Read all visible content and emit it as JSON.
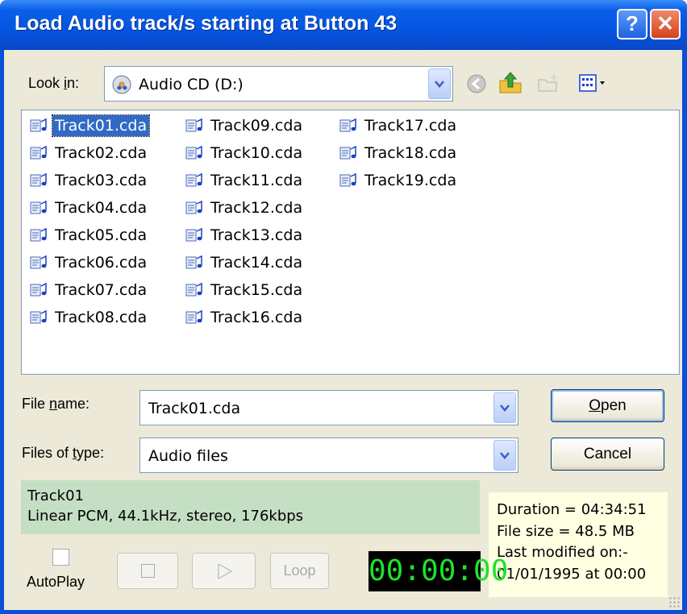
{
  "window": {
    "title": "Load Audio track/s starting at Button 43",
    "help_glyph": "?",
    "close_glyph": "✕"
  },
  "look_in": {
    "label": "Look in:",
    "value": "Audio CD (D:)"
  },
  "toolbar": {
    "back_icon": "back-arrow-icon",
    "up_icon": "up-folder-icon",
    "new_folder_icon": "new-folder-icon",
    "views_icon": "views-menu-icon"
  },
  "files": [
    {
      "name": "Track01.cda",
      "selected": true
    },
    {
      "name": "Track02.cda"
    },
    {
      "name": "Track03.cda"
    },
    {
      "name": "Track04.cda"
    },
    {
      "name": "Track05.cda"
    },
    {
      "name": "Track06.cda"
    },
    {
      "name": "Track07.cda"
    },
    {
      "name": "Track08.cda"
    },
    {
      "name": "Track09.cda"
    },
    {
      "name": "Track10.cda"
    },
    {
      "name": "Track11.cda"
    },
    {
      "name": "Track12.cda"
    },
    {
      "name": "Track13.cda"
    },
    {
      "name": "Track14.cda"
    },
    {
      "name": "Track15.cda"
    },
    {
      "name": "Track16.cda"
    },
    {
      "name": "Track17.cda"
    },
    {
      "name": "Track18.cda"
    },
    {
      "name": "Track19.cda"
    }
  ],
  "file_name": {
    "label": "File name:",
    "value": "Track01.cda"
  },
  "file_type": {
    "label": "Files of type:",
    "value": "Audio files"
  },
  "buttons": {
    "open": "Open",
    "cancel": "Cancel"
  },
  "info": {
    "track": "Track01",
    "format": "Linear PCM, 44.1kHz, stereo, 176kbps"
  },
  "details": {
    "duration": "Duration = 04:34:51",
    "size": "File size = 48.5 MB",
    "modified_label": "Last modified on:-",
    "modified": "01/01/1995 at 00:00"
  },
  "autoplay": {
    "label": "AutoPlay",
    "checked": false
  },
  "controls": {
    "loop": "Loop",
    "time": "00:00:00"
  }
}
